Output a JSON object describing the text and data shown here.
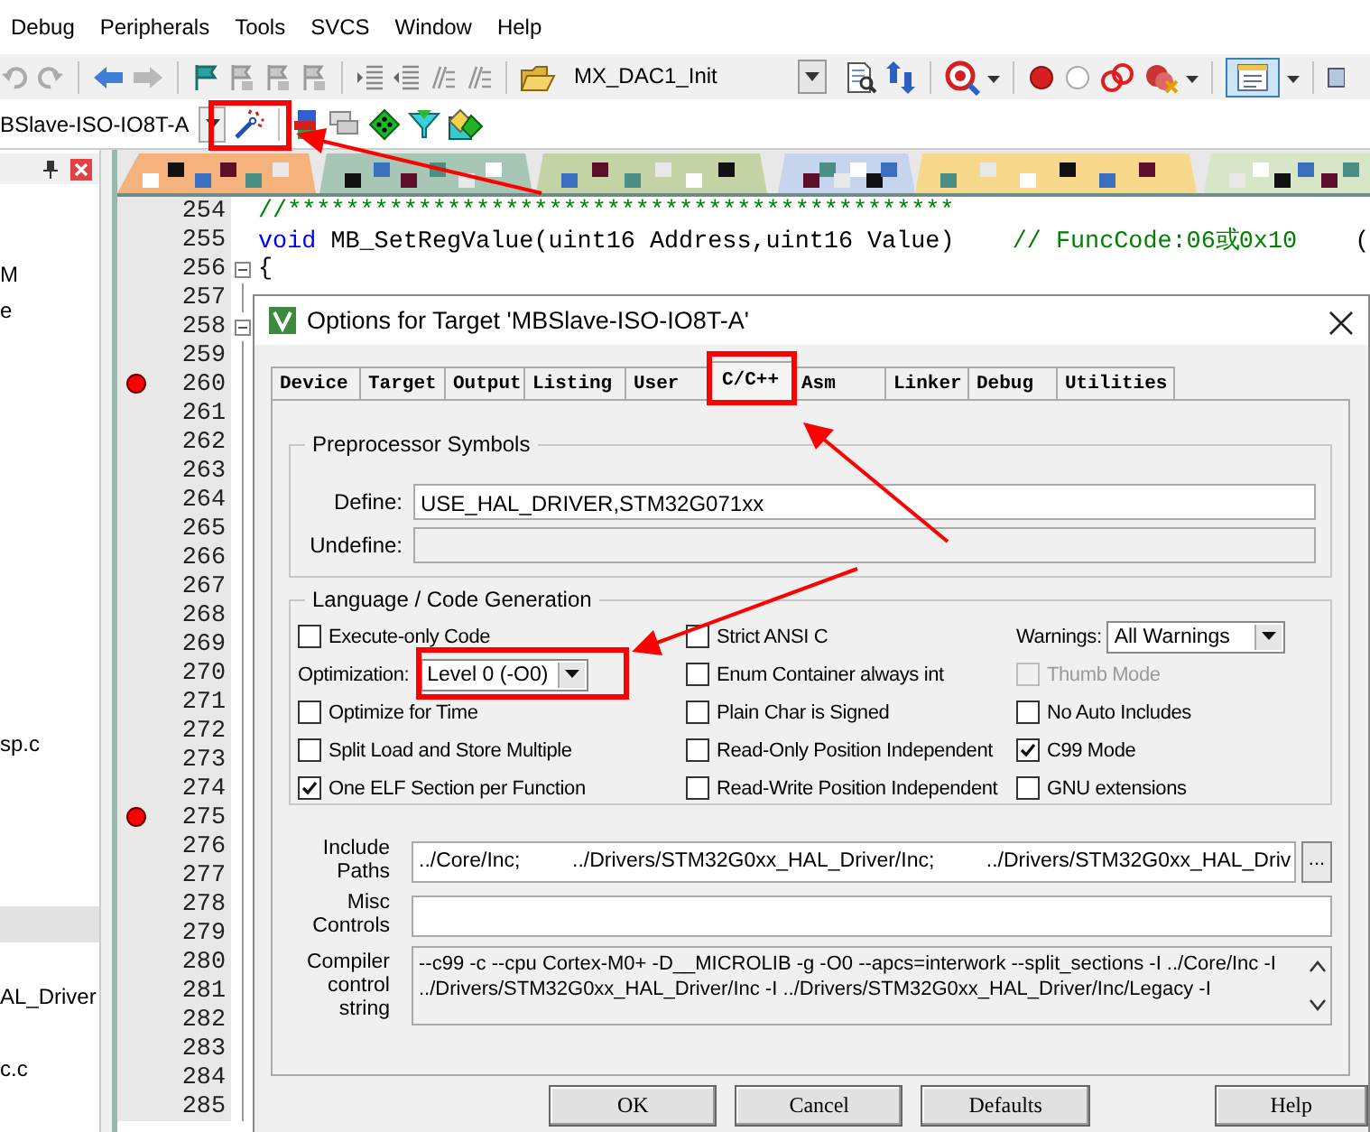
{
  "menu": [
    {
      "label": "Debug"
    },
    {
      "label": "Peripherals"
    },
    {
      "label": "Tools"
    },
    {
      "label": "SVCS"
    },
    {
      "label": "Window"
    },
    {
      "label": "Help"
    }
  ],
  "toolbar": {
    "function_field": "MX_DAC1_Init",
    "view_button_pressed": true
  },
  "target_combo": {
    "value": "BSlave-ISO-IO8T-A"
  },
  "project_panel": {
    "rows": [
      {
        "selected": false
      },
      {
        "selected": false
      },
      {
        "text": "M",
        "selected": false
      },
      {
        "text": "e",
        "selected": false
      },
      {
        "selected": false
      },
      {
        "selected": false
      },
      {
        "selected": false
      },
      {
        "selected": false
      },
      {
        "selected": false
      },
      {
        "selected": false
      },
      {
        "selected": false
      },
      {
        "selected": false
      },
      {
        "selected": false
      },
      {
        "selected": false
      },
      {
        "selected": false
      },
      {
        "text": "sp.c",
        "selected": false
      },
      {
        "selected": false
      },
      {
        "selected": false
      },
      {
        "selected": false
      },
      {
        "selected": false
      },
      {
        "selected": true
      },
      {
        "selected": false
      },
      {
        "text": "AL_Driver",
        "selected": false
      },
      {
        "selected": false
      },
      {
        "text": "c.c",
        "selected": false
      }
    ]
  },
  "editor": {
    "lines": [
      {
        "number": "254",
        "breakpoint": false,
        "fold_box": false,
        "fold_guide": false,
        "tokens": [
          {
            "kind": "comment",
            "text": "//**********************************************"
          }
        ]
      },
      {
        "number": "255",
        "breakpoint": false,
        "fold_box": false,
        "fold_guide": false,
        "tokens": [
          {
            "kind": "keyword",
            "text": "void"
          },
          {
            "kind": "plain",
            "text": " MB_SetRegValue(uint16 Address,uint16 Value)    "
          },
          {
            "kind": "comment",
            "text": "// FuncCode:06或0x10"
          },
          {
            "kind": "plain",
            "text": "    ("
          }
        ]
      },
      {
        "number": "256",
        "breakpoint": false,
        "fold_box": true,
        "fold_guide": false,
        "tokens": [
          {
            "kind": "plain",
            "text": "{"
          }
        ]
      },
      {
        "number": "257",
        "breakpoint": false,
        "fold_box": false,
        "fold_guide": true
      },
      {
        "number": "258",
        "breakpoint": false,
        "fold_box": true,
        "fold_guide": false
      },
      {
        "number": "259",
        "breakpoint": false,
        "fold_box": false,
        "fold_guide": true
      },
      {
        "number": "260",
        "breakpoint": true,
        "fold_box": false,
        "fold_guide": true
      },
      {
        "number": "261",
        "breakpoint": false,
        "fold_box": false,
        "fold_guide": true
      },
      {
        "number": "262",
        "breakpoint": false,
        "fold_box": false,
        "fold_guide": true
      },
      {
        "number": "263",
        "breakpoint": false,
        "fold_box": false,
        "fold_guide": true
      },
      {
        "number": "264",
        "breakpoint": false,
        "fold_box": false,
        "fold_guide": true
      },
      {
        "number": "265",
        "breakpoint": false,
        "fold_box": false,
        "fold_guide": true
      },
      {
        "number": "266",
        "breakpoint": false,
        "fold_box": false,
        "fold_guide": true
      },
      {
        "number": "267",
        "breakpoint": false,
        "fold_box": false,
        "fold_guide": true
      },
      {
        "number": "268",
        "breakpoint": false,
        "fold_box": false,
        "fold_guide": true
      },
      {
        "number": "269",
        "breakpoint": false,
        "fold_box": false,
        "fold_guide": true
      },
      {
        "number": "270",
        "breakpoint": false,
        "fold_box": false,
        "fold_guide": true
      },
      {
        "number": "271",
        "breakpoint": false,
        "fold_box": false,
        "fold_guide": true
      },
      {
        "number": "272",
        "breakpoint": false,
        "fold_box": false,
        "fold_guide": true
      },
      {
        "number": "273",
        "breakpoint": false,
        "fold_box": false,
        "fold_guide": true
      },
      {
        "number": "274",
        "breakpoint": false,
        "fold_box": false,
        "fold_guide": true
      },
      {
        "number": "275",
        "breakpoint": true,
        "fold_box": false,
        "fold_guide": true
      },
      {
        "number": "276",
        "breakpoint": false,
        "fold_box": false,
        "fold_guide": true
      },
      {
        "number": "277",
        "breakpoint": false,
        "fold_box": false,
        "fold_guide": true
      },
      {
        "number": "278",
        "breakpoint": false,
        "fold_box": false,
        "fold_guide": true
      },
      {
        "number": "279",
        "breakpoint": false,
        "fold_box": false,
        "fold_guide": true
      },
      {
        "number": "280",
        "breakpoint": false,
        "fold_box": false,
        "fold_guide": true
      },
      {
        "number": "281",
        "breakpoint": false,
        "fold_box": false,
        "fold_guide": true
      },
      {
        "number": "282",
        "breakpoint": false,
        "fold_box": false,
        "fold_guide": true
      },
      {
        "number": "283",
        "breakpoint": false,
        "fold_box": false,
        "fold_guide": true
      },
      {
        "number": "284",
        "breakpoint": false,
        "fold_box": false,
        "fold_guide": true
      },
      {
        "number": "285",
        "breakpoint": false,
        "fold_box": false,
        "fold_guide": true
      }
    ]
  },
  "dialog": {
    "title": "Options for Target 'MBSlave-ISO-IO8T-A'",
    "tabs": [
      {
        "label": "Device",
        "selected": false
      },
      {
        "label": "Target",
        "selected": false
      },
      {
        "label": "Output",
        "selected": false
      },
      {
        "label": "Listing",
        "selected": false
      },
      {
        "label": "User",
        "selected": false
      },
      {
        "label": "C/C++",
        "selected": true
      },
      {
        "label": "Asm",
        "selected": false
      },
      {
        "label": "Linker",
        "selected": false
      },
      {
        "label": "Debug",
        "selected": false
      },
      {
        "label": "Utilities",
        "selected": false
      }
    ],
    "preprocessor": {
      "title": "Preprocessor Symbols",
      "define_label": "Define:",
      "define_value": "USE_HAL_DRIVER,STM32G071xx",
      "undefine_label": "Undefine:"
    },
    "language": {
      "title": "Language / Code Generation",
      "columns": [
        [
          {
            "kind": "checkbox",
            "label": "Execute-only Code",
            "checked": false,
            "disabled": false
          },
          {
            "kind": "select",
            "label": "Optimization:",
            "value": "Level 0 (-O0)"
          },
          {
            "kind": "checkbox",
            "label": "Optimize for Time",
            "checked": false,
            "disabled": false
          },
          {
            "kind": "checkbox",
            "label": "Split Load and Store Multiple",
            "checked": false,
            "disabled": false
          },
          {
            "kind": "checkbox",
            "label": "One ELF Section per Function",
            "checked": true,
            "disabled": false
          }
        ],
        [
          {
            "kind": "checkbox",
            "label": "Strict ANSI C",
            "checked": false,
            "disabled": false
          },
          {
            "kind": "checkbox",
            "label": "Enum Container always int",
            "checked": false,
            "disabled": false
          },
          {
            "kind": "checkbox",
            "label": "Plain Char is Signed",
            "checked": false,
            "disabled": false
          },
          {
            "kind": "checkbox",
            "label": "Read-Only Position Independent",
            "checked": false,
            "disabled": false
          },
          {
            "kind": "checkbox",
            "label": "Read-Write Position Independent",
            "checked": false,
            "disabled": false
          }
        ],
        [
          {
            "kind": "select",
            "label": "Warnings:",
            "value": "All Warnings"
          },
          {
            "kind": "checkbox",
            "label": "Thumb Mode",
            "checked": false,
            "disabled": true
          },
          {
            "kind": "checkbox",
            "label": "No Auto Includes",
            "checked": false,
            "disabled": false
          },
          {
            "kind": "checkbox",
            "label": "C99 Mode",
            "checked": true,
            "disabled": false
          },
          {
            "kind": "checkbox",
            "label": "GNU extensions",
            "checked": false,
            "disabled": false
          }
        ]
      ]
    },
    "include_paths": {
      "label": "Include Paths",
      "value": "../Core/Inc;         ../Drivers/STM32G0xx_HAL_Driver/Inc;         ../Drivers/STM32G0xx_HAL_Driv",
      "browse_label": "..."
    },
    "misc_controls": {
      "label": "Misc Controls"
    },
    "compiler_string": {
      "label": "Compiler control string",
      "lines": [
        "--c99 -c --cpu Cortex-M0+ -D__MICROLIB -g -O0 --apcs=interwork --split_sections -I ../Core/Inc -I",
        "../Drivers/STM32G0xx_HAL_Driver/Inc -I ../Drivers/STM32G0xx_HAL_Driver/Inc/Legacy -I"
      ]
    },
    "buttons": [
      {
        "label": "OK"
      },
      {
        "label": "Cancel"
      },
      {
        "label": "Defaults"
      },
      {
        "label": "Help"
      }
    ]
  }
}
